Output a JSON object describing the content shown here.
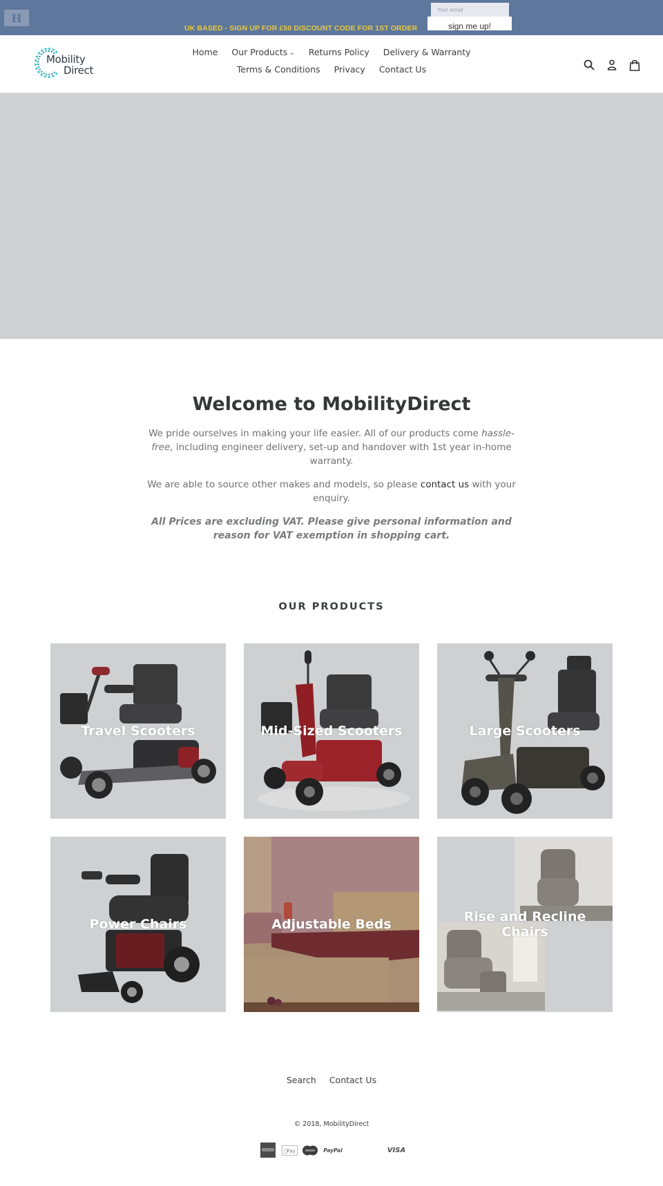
{
  "promo": {
    "badge_glyph": "H",
    "message": "UK BASED - SIGN UP FOR £50 DISCOUNT CODE FOR 1ST ORDER",
    "email_placeholder": "Your email",
    "submit_label": "sign me up!",
    "colors": {
      "bar": "#5e779c",
      "message": "#e8c840"
    }
  },
  "header": {
    "logo": {
      "line1": "Mobility",
      "line2": "Direct",
      "accent": "#3bc3c8"
    },
    "nav_row1": [
      {
        "label": "Home"
      },
      {
        "label": "Our Products",
        "has_dropdown": true,
        "chevron": "⌄"
      },
      {
        "label": "Returns Policy"
      },
      {
        "label": "Delivery & Warranty"
      }
    ],
    "nav_row2": [
      {
        "label": "Terms & Conditions"
      },
      {
        "label": "Privacy"
      },
      {
        "label": "Contact Us"
      }
    ],
    "icons": [
      "search-icon",
      "account-icon",
      "cart-icon"
    ]
  },
  "welcome": {
    "title": "Welcome to MobilityDirect",
    "para1_before": "We pride ourselves in making your life easier. All of our products come ",
    "para1_em": "hassle-free",
    "para1_after": ", including engineer delivery, set-up and handover with 1st year in-home warranty.",
    "para2_before": "We are able to source other makes and models, so please ",
    "para2_link": "contact us",
    "para2_after": " with your enquiry.",
    "vat_note": "All Prices are excluding VAT. Please give personal information and reason for VAT exemption in shopping cart."
  },
  "products": {
    "title": "OUR PRODUCTS",
    "items": [
      {
        "label": "Travel Scooters"
      },
      {
        "label": "Mid-Sized Scooters"
      },
      {
        "label": "Large Scooters"
      },
      {
        "label": "Power Chairs"
      },
      {
        "label": "Adjustable Beds"
      },
      {
        "label": "Rise and Recline Chairs"
      }
    ]
  },
  "footer": {
    "links": [
      {
        "label": "Search"
      },
      {
        "label": "Contact Us"
      }
    ],
    "copyright": "© 2018, MobilityDirect",
    "payments": [
      "American Express",
      "Apple Pay",
      "Mastercard",
      "PayPal",
      "Visa"
    ],
    "payment_labels": {
      "apple": "Pay",
      "paypal": "PayPal",
      "visa": "VISA"
    }
  }
}
